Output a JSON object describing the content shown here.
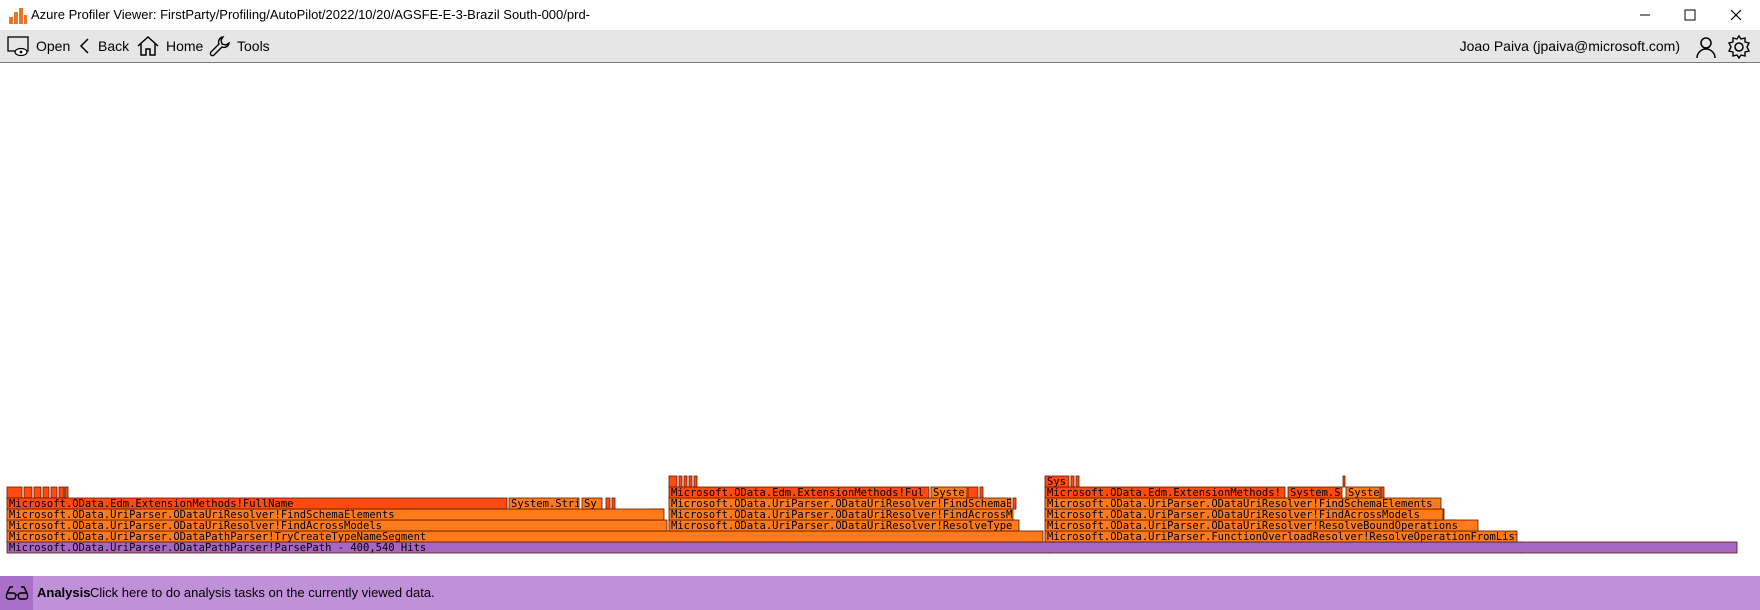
{
  "window": {
    "title": "Azure Profiler Viewer: FirstParty/Profiling/AutoPilot/2022/10/20/AGSFE-E-3-Brazil South-000/prd-"
  },
  "toolbar": {
    "open_label": "Open",
    "back_label": "Back",
    "home_label": "Home",
    "tools_label": "Tools",
    "user_label": "Joao Paiva (jpaiva@microsoft.com)"
  },
  "colors": {
    "root": "#a866c4",
    "frame_orange": "#ff7a1a",
    "frame_red": "#ff4a10",
    "status_bg": "#c090d8",
    "toolbar_bg": "#e6e6e6"
  },
  "flame": {
    "frames": [
      {
        "label": "Microsoft.OData.UriParser.ODataPathParser!ParsePath - 400,540 Hits",
        "color": "root"
      },
      {
        "label": "Microsoft.OData.UriParser.ODataPathParser!TryCreateTypeNameSegment",
        "color": "orange"
      },
      {
        "label": "Microsoft.OData.UriParser.ODataUriResolver!FindAcrossModels",
        "color": "orange"
      },
      {
        "label": "Microsoft.OData.UriParser.ODataUriResolver!FindSchemaElements",
        "color": "orange"
      },
      {
        "label": "Microsoft.OData.Edm.ExtensionMethods!FullName",
        "color": "red"
      },
      {
        "label": "System.Stri",
        "color": "orange"
      },
      {
        "label": "Sy",
        "color": "orange"
      },
      {
        "label": "Microsoft.OData.UriParser.ODataUriResolver!ResolveType",
        "color": "orange"
      },
      {
        "label": "Microsoft.OData.UriParser.ODataUriResolver!FindAcrossM",
        "color": "orange"
      },
      {
        "label": "Microsoft.OData.UriParser.ODataUriResolver!FindSchemaE",
        "color": "orange"
      },
      {
        "label": "Microsoft.OData.Edm.ExtensionMethods!Ful",
        "color": "red"
      },
      {
        "label": "Syste",
        "color": "orange"
      },
      {
        "label": "Microsoft.OData.UriParser.FunctionOverloadResolver!ResolveOperationFromList",
        "color": "orange"
      },
      {
        "label": "Microsoft.OData.UriParser.ODataUriResolver!ResolveBoundOperations",
        "color": "orange"
      },
      {
        "label": "Microsoft.OData.UriParser.ODataUriResolver!FindAcrossModels",
        "color": "orange"
      },
      {
        "label": "Microsoft.OData.UriParser.ODataUriResolver!FindSchemaElements",
        "color": "orange"
      },
      {
        "label": "Microsoft.OData.Edm.ExtensionMethods!",
        "color": "red"
      },
      {
        "label": "System.S",
        "color": "red"
      },
      {
        "label": "Syste",
        "color": "orange"
      },
      {
        "label": "Sys",
        "color": "red"
      }
    ]
  },
  "status": {
    "title": "Analysis",
    "text": "Click here to do analysis tasks on the currently viewed data."
  }
}
